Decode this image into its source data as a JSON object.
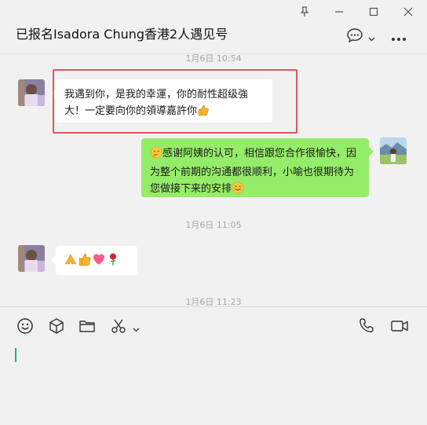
{
  "window": {
    "controls": [
      "pin-icon",
      "minimize-icon",
      "maximize-icon",
      "close-icon"
    ]
  },
  "header": {
    "title": "已报名Isadora Chung香港2人遇见号",
    "icons": [
      "chat-bubble-icon",
      "chevron-down-icon",
      "more-icon"
    ]
  },
  "messages": [
    {
      "type": "time",
      "text": "1月6日 10:54"
    },
    {
      "type": "incoming",
      "text": "我遇到你，是我的幸運，你的耐性超级強大！一定要向你的領導嘉許你",
      "emoji": [
        "thumbs-up"
      ],
      "highlighted": true
    },
    {
      "type": "outgoing",
      "text": "感谢阿姨的认可，相信跟您合作很愉快，因为整个前期的沟通都很顺利，小喻也很期待为您做接下来的安排",
      "emoji": [
        "thinking-face",
        "smiling-face"
      ]
    },
    {
      "type": "time",
      "text": "1月6日 11:05"
    },
    {
      "type": "incoming",
      "emoji": [
        "folded-hands",
        "thumbs-up",
        "heart",
        "rose"
      ]
    },
    {
      "type": "time",
      "text": "1月6日 11:23"
    }
  ],
  "composer": {
    "tools": [
      "emoji-icon",
      "box-icon",
      "folder-icon",
      "scissors-icon",
      "chevron-down-icon",
      "phone-icon",
      "video-icon"
    ],
    "input_value": ""
  },
  "colors": {
    "background": "#f1f1f1",
    "incoming_bubble": "#ffffff",
    "outgoing_bubble": "#95ec69",
    "highlight": "#e05560",
    "caret": "#07c160"
  }
}
